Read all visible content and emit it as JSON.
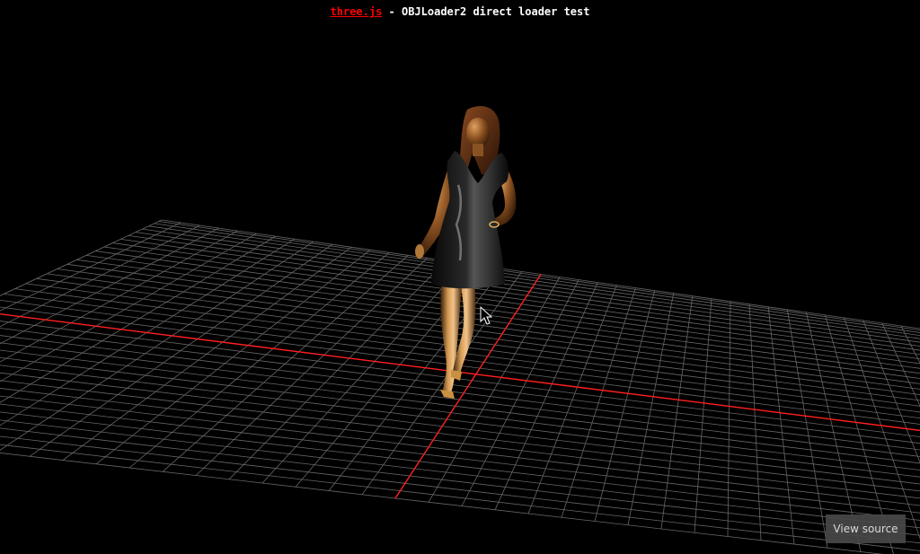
{
  "header": {
    "link_text": "three.js",
    "title_suffix": " - OBJLoader2 direct loader test"
  },
  "footer": {
    "view_source_label": "View source"
  },
  "scene": {
    "background_color": "#000000",
    "grid_line_color": "#8a8a8a",
    "axis_color": "#ff2020",
    "link_color": "#ff0000",
    "model": "female figure in black dress",
    "cursor": "arrow-cursor-icon"
  }
}
